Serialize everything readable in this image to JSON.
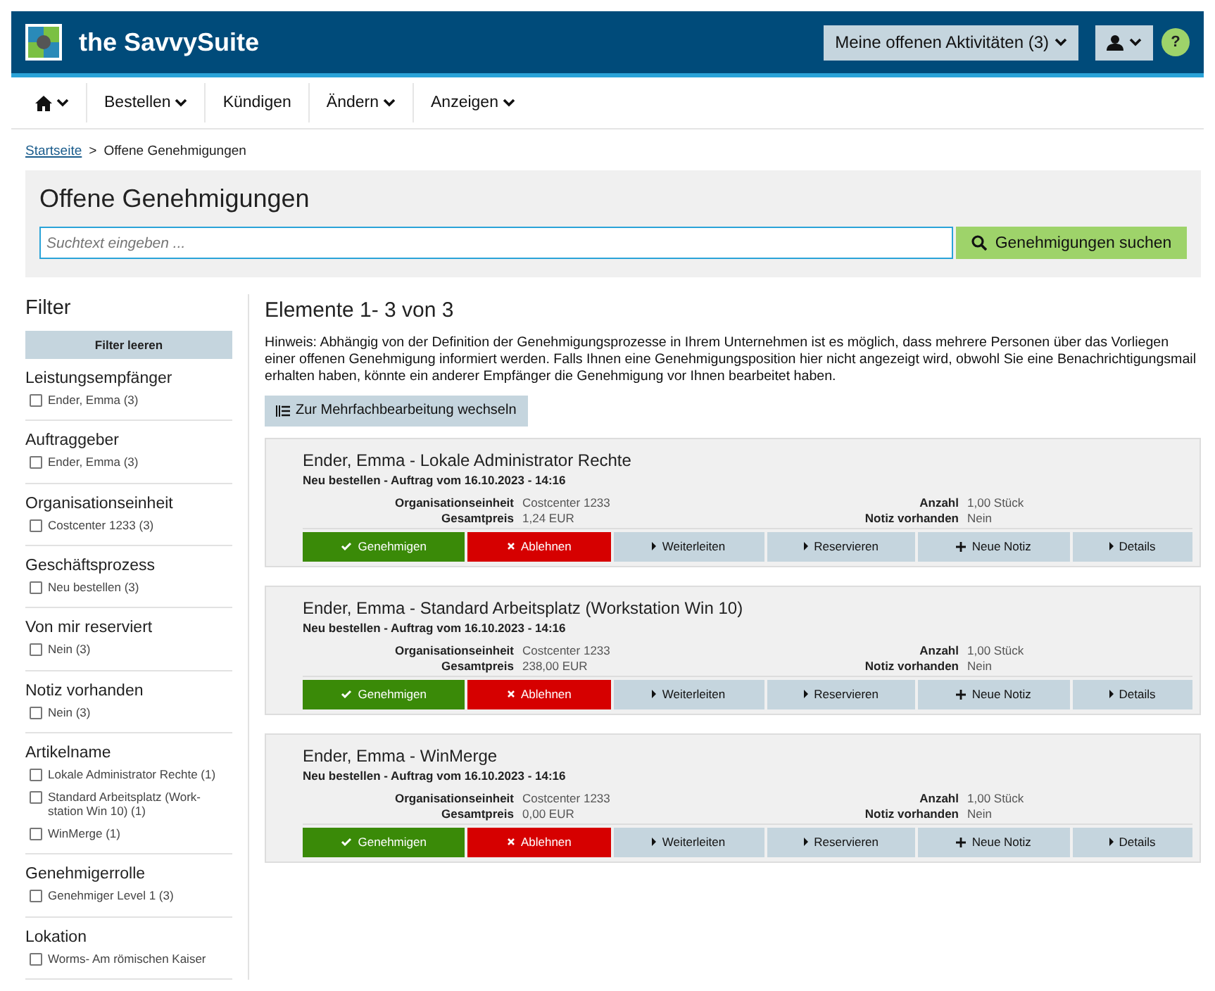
{
  "header": {
    "brand": "the SavvySuite",
    "activities": "Meine offenen Aktivitäten (3)",
    "help": "?"
  },
  "nav": [
    {
      "kind": "home",
      "dropdown": true
    },
    {
      "kind": "text",
      "label": "Bestellen",
      "dropdown": true
    },
    {
      "kind": "text",
      "label": "Kündigen",
      "dropdown": false
    },
    {
      "kind": "text",
      "label": "Ändern",
      "dropdown": true
    },
    {
      "kind": "text",
      "label": "Anzeigen",
      "dropdown": true
    }
  ],
  "breadcrumb": [
    {
      "label": "Startseite",
      "link": true
    },
    {
      "label": "Offene Genehmigungen",
      "link": false
    }
  ],
  "breadcrumb_separator": ">",
  "search": {
    "title": "Offene Genehmigungen",
    "placeholder": "Suchtext eingeben ...",
    "button": "Genehmigungen suchen"
  },
  "filter": {
    "title": "Filter",
    "clear": "Filter leeren",
    "groups": [
      {
        "title": "Leistungsempfänger",
        "options": [
          {
            "label": "Ender, Emma (3)",
            "checked": false
          }
        ]
      },
      {
        "title": "Auftraggeber",
        "options": [
          {
            "label": "Ender, Emma (3)",
            "checked": false
          }
        ]
      },
      {
        "title": "Organisationseinheit",
        "options": [
          {
            "label": "Costcenter 1233 (3)",
            "checked": false
          }
        ]
      },
      {
        "title": "Geschäftsprozess",
        "options": [
          {
            "label": "Neu bestellen (3)",
            "checked": false
          }
        ]
      },
      {
        "title": "Von mir reserviert",
        "options": [
          {
            "label": "Nein (3)",
            "checked": false
          }
        ]
      },
      {
        "title": "Notiz vorhanden",
        "options": [
          {
            "label": "Nein (3)",
            "checked": false
          }
        ]
      },
      {
        "title": "Artikelname",
        "options": [
          {
            "label": "Lokale Administrator Rechte (1)",
            "checked": false
          },
          {
            "label": "Standard Arbeitsplatz (Work-station Win 10) (1)",
            "checked": false
          },
          {
            "label": "WinMerge (1)",
            "checked": false
          }
        ]
      },
      {
        "title": "Genehmigerrolle",
        "options": [
          {
            "label": "Genehmiger Level 1 (3)",
            "checked": false
          }
        ]
      },
      {
        "title": "Lokation",
        "options": [
          {
            "label": "Worms- Am römischen Kaiser",
            "checked": false
          }
        ]
      }
    ]
  },
  "results": {
    "title": "Elemente 1- 3 von 3",
    "hint": "Hinweis: Abhängig von der Definition der Genehmigungsprozesse in Ihrem Unternehmen ist es möglich, dass mehrere Personen über das Vorliegen einer offenen Genehmigung informiert werden. Falls Ihnen eine Genehmigungsposition hier nicht angezeigt wird, obwohl Sie eine Benachrichtigungsmail erhalten haben, könnte ein anderer Empfänger die Genehmigung vor Ihnen bearbeitet haben.",
    "bulk_button": "Zur Mehrfachbearbeitung wechseln",
    "items": [
      {
        "title": "Ender, Emma - Lokale Administrator Rechte",
        "subtitle": "Neu bestellen - Auftrag vom 16.10.2023 - 14:16",
        "fields_left": [
          {
            "label": "Organisationseinheit",
            "value": "Costcenter 1233"
          },
          {
            "label": "Gesamtpreis",
            "value": "1,24 EUR"
          }
        ],
        "fields_right": [
          {
            "label": "Anzahl",
            "value": "1,00 Stück"
          },
          {
            "label": "Notiz vorhanden",
            "value": "Nein"
          }
        ],
        "actions": [
          {
            "kind": "approve",
            "label": "Genehmigen"
          },
          {
            "kind": "reject",
            "label": "Ablehnen"
          },
          {
            "kind": "more",
            "label": "Weiterleiten"
          },
          {
            "kind": "more",
            "label": "Reservieren"
          },
          {
            "kind": "add",
            "label": "Neue Notiz"
          },
          {
            "kind": "more",
            "label": "Details"
          }
        ]
      },
      {
        "title": "Ender, Emma - Standard Arbeitsplatz (Workstation Win 10)",
        "subtitle": "Neu bestellen - Auftrag vom 16.10.2023 - 14:16",
        "fields_left": [
          {
            "label": "Organisationseinheit",
            "value": "Costcenter 1233"
          },
          {
            "label": "Gesamtpreis",
            "value": "238,00 EUR"
          }
        ],
        "fields_right": [
          {
            "label": "Anzahl",
            "value": "1,00 Stück"
          },
          {
            "label": "Notiz vorhanden",
            "value": "Nein"
          }
        ],
        "actions": [
          {
            "kind": "approve",
            "label": "Genehmigen"
          },
          {
            "kind": "reject",
            "label": "Ablehnen"
          },
          {
            "kind": "more",
            "label": "Weiterleiten"
          },
          {
            "kind": "more",
            "label": "Reservieren"
          },
          {
            "kind": "add",
            "label": "Neue Notiz"
          },
          {
            "kind": "more",
            "label": "Details"
          }
        ]
      },
      {
        "title": "Ender, Emma - WinMerge",
        "subtitle": "Neu bestellen - Auftrag vom 16.10.2023 - 14:16",
        "fields_left": [
          {
            "label": "Organisationseinheit",
            "value": "Costcenter 1233"
          },
          {
            "label": "Gesamtpreis",
            "value": "0,00 EUR"
          }
        ],
        "fields_right": [
          {
            "label": "Anzahl",
            "value": "1,00 Stück"
          },
          {
            "label": "Notiz vorhanden",
            "value": "Nein"
          }
        ],
        "actions": [
          {
            "kind": "approve",
            "label": "Genehmigen"
          },
          {
            "kind": "reject",
            "label": "Ablehnen"
          },
          {
            "kind": "more",
            "label": "Weiterleiten"
          },
          {
            "kind": "more",
            "label": "Reservieren"
          },
          {
            "kind": "add",
            "label": "Neue Notiz"
          },
          {
            "kind": "more",
            "label": "Details"
          }
        ]
      }
    ]
  }
}
